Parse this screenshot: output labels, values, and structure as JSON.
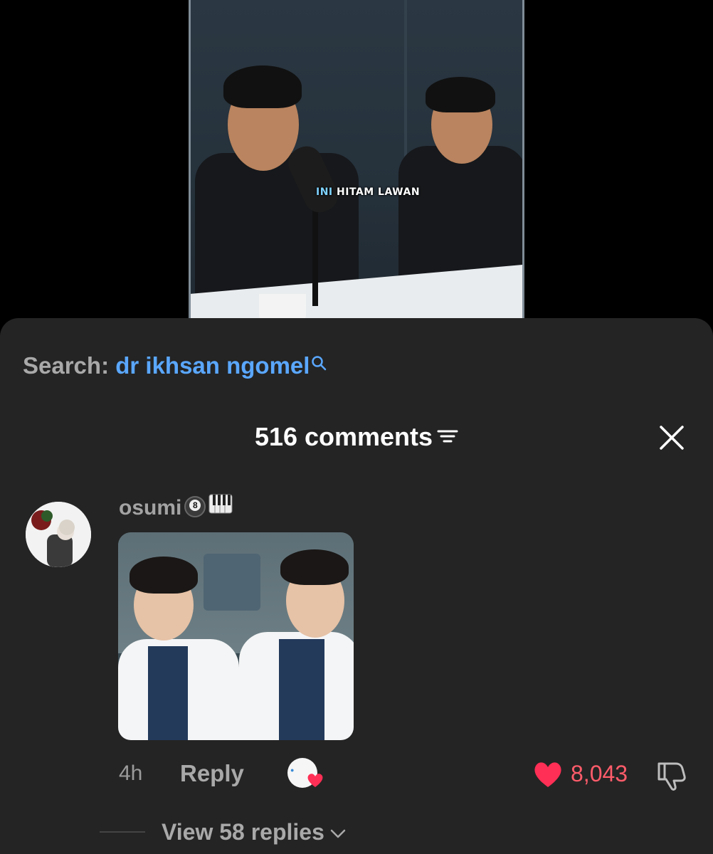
{
  "video": {
    "caption_highlight": "INI",
    "caption_rest": "HITAM LAWAN"
  },
  "search": {
    "prefix": "Search:",
    "query": "dr ikhsan ngomel",
    "icon": "search-icon"
  },
  "comments": {
    "header": "516 comments",
    "sort_icon": "sort-icon",
    "close_icon": "close-icon"
  },
  "comment": {
    "username": "osumi",
    "badge": "8",
    "time": "4h",
    "reply_label": "Reply",
    "like_count": "8,043",
    "view_replies": "View 58 replies",
    "colors": {
      "like": "#ff2f55",
      "link": "#5aa7ff",
      "muted": "#a9a9a9",
      "sheet": "#242424"
    }
  }
}
